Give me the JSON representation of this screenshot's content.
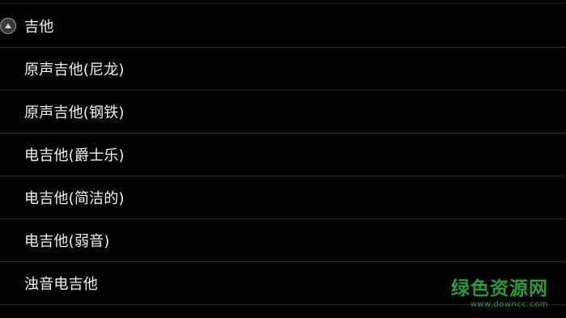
{
  "group": {
    "title": "吉他",
    "expanded": true,
    "toggle_icon": "collapse-arrow-up-icon"
  },
  "items": [
    {
      "label": "原声吉他(尼龙)"
    },
    {
      "label": "原声吉他(钢铁)"
    },
    {
      "label": "电吉他(爵士乐)"
    },
    {
      "label": "电吉他(简洁的)"
    },
    {
      "label": "电吉他(弱音)"
    },
    {
      "label": "浊音电吉他"
    }
  ],
  "watermark": {
    "title": "绿色资源网",
    "url": "www.downcc.com",
    "color": "#2f9a3b"
  },
  "colors": {
    "background": "#030303",
    "text": "#f2f2f2",
    "divider": "#2a2a2a"
  }
}
